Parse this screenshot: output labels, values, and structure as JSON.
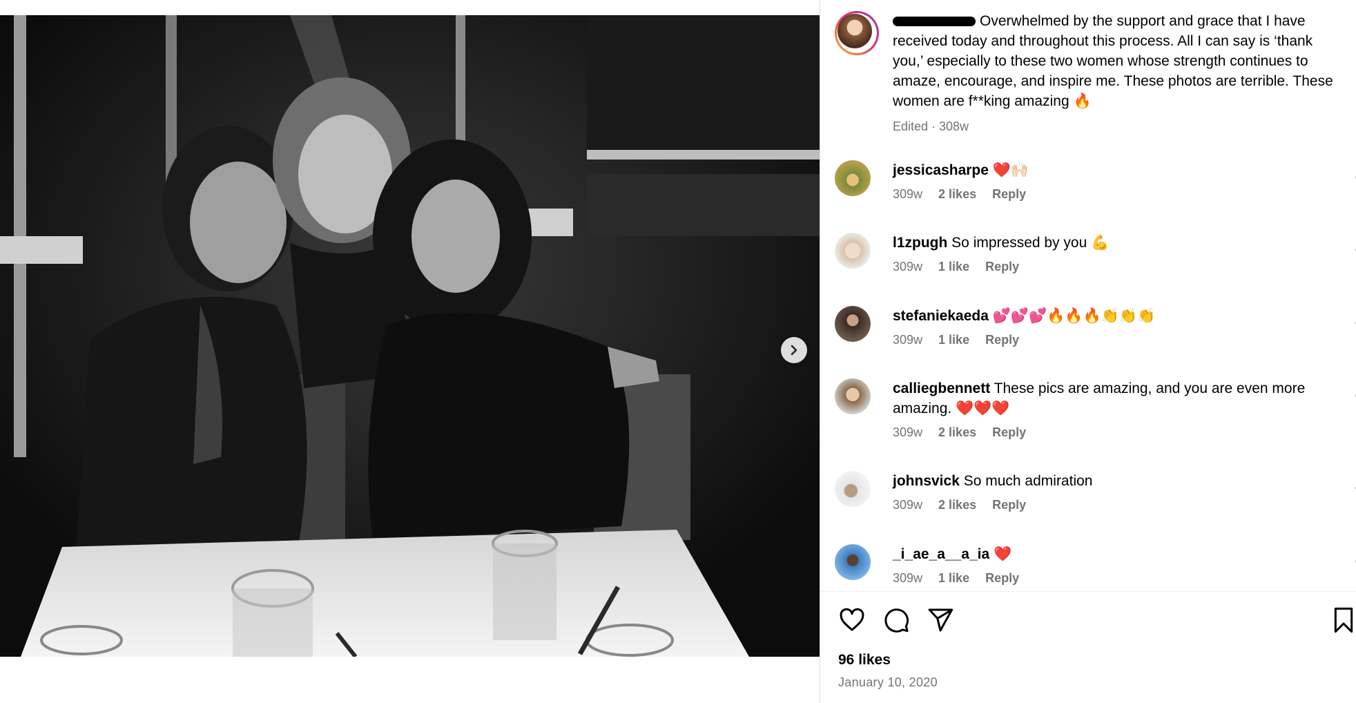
{
  "post": {
    "caption": "Overwhelmed by the support and grace that I have received today and throughout this process. All I can say is ‘thank you,’ especially to these two women whose strength continues to amaze, encourage, and inspire me. These photos are terrible. These women are f**king amazing 🔥",
    "edited": "Edited · 308w",
    "likes": "96 likes",
    "date": "January 10, 2020"
  },
  "comments": [
    {
      "user": "jessicasharpe",
      "text": "❤️🙌🏻",
      "age": "309w",
      "likes": "2 likes",
      "reply": "Reply"
    },
    {
      "user": "l1zpugh",
      "text": "So impressed by you 💪",
      "age": "309w",
      "likes": "1 like",
      "reply": "Reply"
    },
    {
      "user": "stefaniekaeda",
      "text": "💕💕💕🔥🔥🔥👏👏👏",
      "age": "309w",
      "likes": "1 like",
      "reply": "Reply"
    },
    {
      "user": "calliegbennett",
      "text": "These pics are amazing, and you are even more amazing. ❤️❤️❤️",
      "age": "309w",
      "likes": "2 likes",
      "reply": "Reply"
    },
    {
      "user": "johnsvick",
      "text": "So much admiration",
      "age": "309w",
      "likes": "2 likes",
      "reply": "Reply"
    },
    {
      "user": "_i_ae_a__a_ia",
      "text": "❤️",
      "age": "309w",
      "likes": "1 like",
      "reply": "Reply"
    }
  ],
  "icons": {
    "next": "chevron-right-icon",
    "like": "heart-outline-icon",
    "comment": "comment-bubble-icon",
    "share": "paper-plane-icon",
    "save": "bookmark-icon"
  },
  "colors": {
    "muted": "#737373",
    "divider": "#dbdbdb"
  }
}
